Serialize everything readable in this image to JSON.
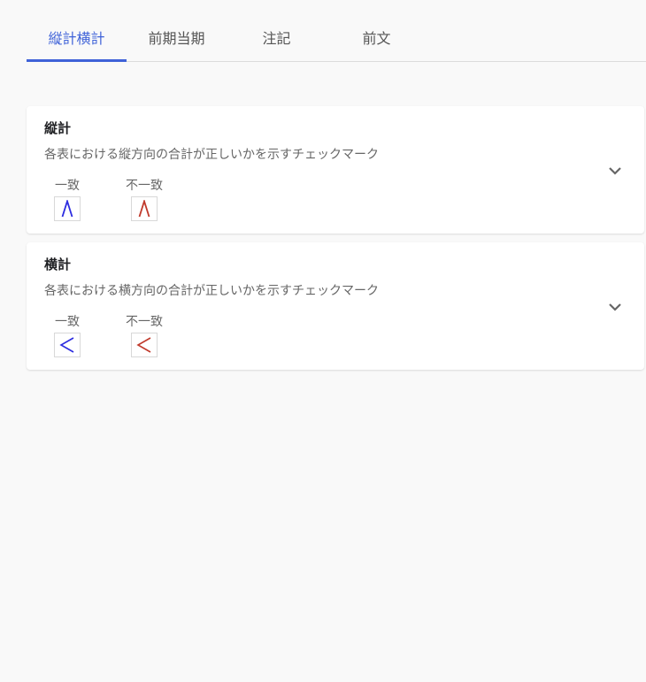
{
  "tabs": [
    {
      "label": "縦計横計",
      "active": true
    },
    {
      "label": "前期当期",
      "active": false
    },
    {
      "label": "注記",
      "active": false
    },
    {
      "label": "前文",
      "active": false
    }
  ],
  "cards": [
    {
      "title": "縦計",
      "description": "各表における縦方向の合計が正しいかを示すチェックマーク",
      "legend": [
        {
          "label": "一致",
          "mark": "caret-up-icon",
          "color": "#2c2ce0"
        },
        {
          "label": "不一致",
          "mark": "caret-up-icon",
          "color": "#c0392b"
        }
      ]
    },
    {
      "title": "横計",
      "description": "各表における横方向の合計が正しいかを示すチェックマーク",
      "legend": [
        {
          "label": "一致",
          "mark": "less-than-icon",
          "color": "#2c2ce0"
        },
        {
          "label": "不一致",
          "mark": "less-than-icon",
          "color": "#c0392b"
        }
      ]
    }
  ],
  "colors": {
    "accent": "#3f62d8",
    "match": "#2c2ce0",
    "mismatch": "#c0392b"
  }
}
